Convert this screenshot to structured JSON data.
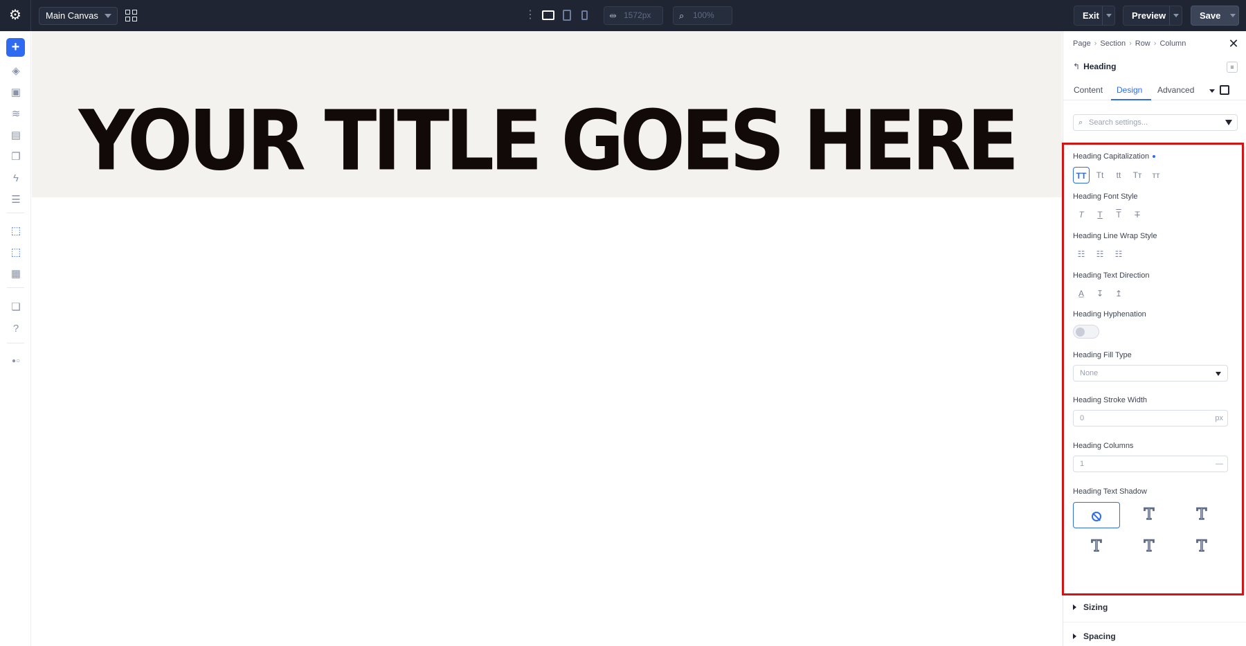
{
  "topbar": {
    "canvas_name": "Main Canvas",
    "width_value": "1572px",
    "zoom_value": "100%",
    "exit_label": "Exit",
    "preview_label": "Preview",
    "save_label": "Save"
  },
  "canvas": {
    "title": "YOUR TITLE GOES HERE"
  },
  "panel": {
    "breadcrumb": [
      "Page",
      "Section",
      "Row",
      "Column"
    ],
    "module_title": "Heading",
    "tabs": [
      "Content",
      "Design",
      "Advanced"
    ],
    "active_tab": "Design",
    "search_placeholder": "Search settings...",
    "fields": {
      "capitalization": "Heading Capitalization",
      "font_style": "Heading Font Style",
      "line_wrap": "Heading Line Wrap Style",
      "text_direction": "Heading Text Direction",
      "hyphenation": "Heading Hyphenation",
      "fill_type": "Heading Fill Type",
      "stroke_width": "Heading Stroke Width",
      "columns": "Heading Columns",
      "text_shadow": "Heading Text Shadow"
    },
    "capitalization_options": [
      "TT",
      "Tt",
      "tt",
      "Tт",
      "ᴛᴛ"
    ],
    "fill_type_value": "None",
    "stroke_width_value": "0",
    "stroke_width_unit": "px",
    "columns_value": "1",
    "columns_unit": "—",
    "sections": [
      "Sizing",
      "Spacing"
    ]
  },
  "colors": {
    "accent": "#2f6bf1",
    "topbar_bg": "#1f2533",
    "highlight_border": "#d31414",
    "hero_bg": "#f4f2ee"
  }
}
